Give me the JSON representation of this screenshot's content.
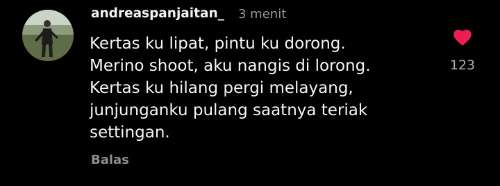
{
  "comment": {
    "username": "andreaspanjaitan_",
    "timestamp": "3 menit",
    "lines": [
      "Kertas ku lipat, pintu ku dorong.",
      "Merino shoot, aku nangis di lorong.",
      "Kertas ku hilang pergi melayang,",
      "junjunganku pulang saatnya teriak",
      "settingan."
    ],
    "reply_label": "Balas",
    "like": {
      "icon": "heart-icon",
      "count": "123",
      "liked": true,
      "color": "#ee1d52"
    }
  }
}
